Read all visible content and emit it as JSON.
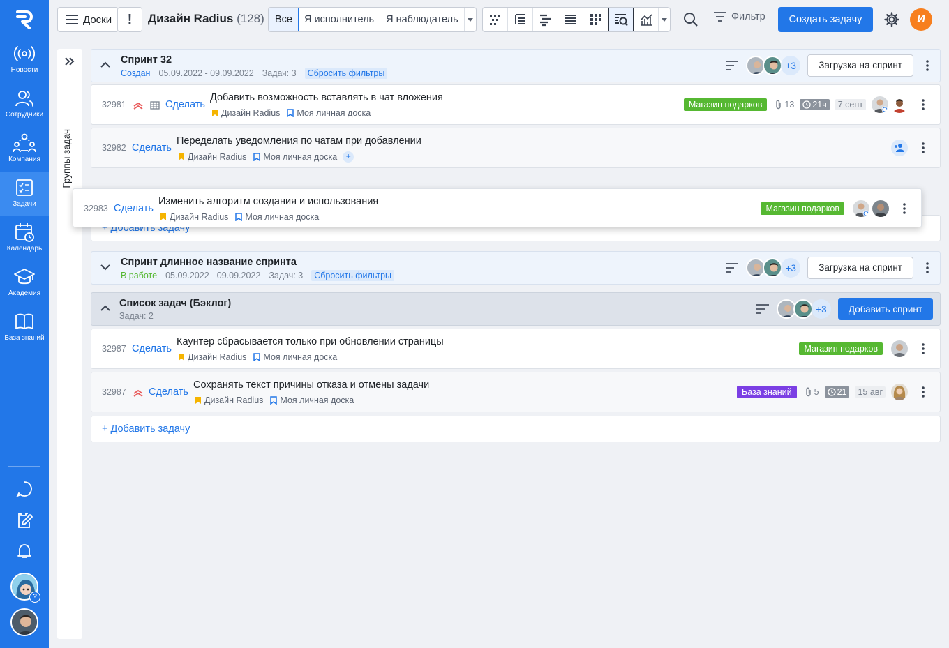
{
  "sidebar": {
    "items": [
      {
        "label": "Новости",
        "icon": "broadcast-icon"
      },
      {
        "label": "Сотрудники",
        "icon": "users-icon"
      },
      {
        "label": "Компания",
        "icon": "company-icon"
      },
      {
        "label": "Задачи",
        "icon": "tasks-icon"
      },
      {
        "label": "Календарь",
        "icon": "calendar-icon"
      },
      {
        "label": "Академия",
        "icon": "graduation-cap-icon"
      },
      {
        "label": "База знаний",
        "icon": "book-icon"
      }
    ],
    "help_badge": "?"
  },
  "topbar": {
    "boards_label": "Доски",
    "alert_label": "!",
    "project_title": "Дизайн Radius",
    "project_count": "(128)",
    "segments": [
      "Все",
      "Я исполнитель",
      "Я наблюдатель"
    ],
    "filter_label": "Фильтр",
    "create_task_label": "Создать задачу",
    "user_initial": "И"
  },
  "groups_panel": {
    "label": "Группы задач"
  },
  "sprints": [
    {
      "name": "Спринт 32",
      "status": "Создан",
      "dates": "05.09.2022 - 09.09.2022",
      "tasks_count": "Задач: 3",
      "reset_filters": "Сбросить фильтры",
      "more_count": "+3",
      "load_label": "Загрузка на спринт"
    },
    {
      "name": "Спринт длинное название спринта",
      "status": "В работе",
      "dates": "05.09.2022 - 09.09.2022",
      "tasks_count": "Задач: 3",
      "reset_filters": "Сбросить фильтры",
      "more_count": "+3",
      "load_label": "Загрузка на спринт"
    }
  ],
  "backlog": {
    "name": "Список задач (Бэклог)",
    "tasks_count": "Задач: 2",
    "more_count": "+3",
    "add_sprint_label": "Добавить спринт"
  },
  "tasks": [
    {
      "id": "32981",
      "action": "Сделать",
      "title": "Добавить возможность вставлять в чат вложения",
      "project": "Дизайн Radius",
      "board": "Моя личная доска",
      "tag": "Магазин подарков",
      "tag_color": "#56b832",
      "attachments": "13",
      "time": "21ч",
      "date": "7 сент"
    },
    {
      "id": "32982",
      "action": "Сделать",
      "title": "Переделать уведомления по чатам при добавлении",
      "project": "Дизайн Radius",
      "board": "Моя личная доска",
      "add_board": "+"
    },
    {
      "id": "32983",
      "action": "Сделать",
      "title": "Изменить алгоритм создания и использования",
      "project": "Дизайн Radius",
      "board": "Моя личная доска",
      "tag": "Магазин подарков",
      "tag_color": "#56b832"
    },
    {
      "id": "32987",
      "action": "Сделать",
      "title": "Каунтер сбрасывается только при обновлении страницы",
      "project": "Дизайн Radius",
      "board": "Моя личная доска",
      "tag": "Магазин подарков",
      "tag_color": "#56b832"
    },
    {
      "id": "32987",
      "action": "Сделать",
      "title": "Сохранять текст причины отказа и отмены задачи",
      "project": "Дизайн Radius",
      "board": "Моя личная доска",
      "tag": "База знаний",
      "tag_color": "#7b3fe4",
      "attachments": "5",
      "time": "21",
      "date": "15 авг"
    }
  ],
  "add_task_label": "+ Добавить задачу",
  "colors": {
    "accent": "#2277e8",
    "tag_green": "#56b832",
    "tag_purple": "#7b3fe4",
    "priority": "#e95b5b",
    "bookmark": "#f5b400"
  }
}
